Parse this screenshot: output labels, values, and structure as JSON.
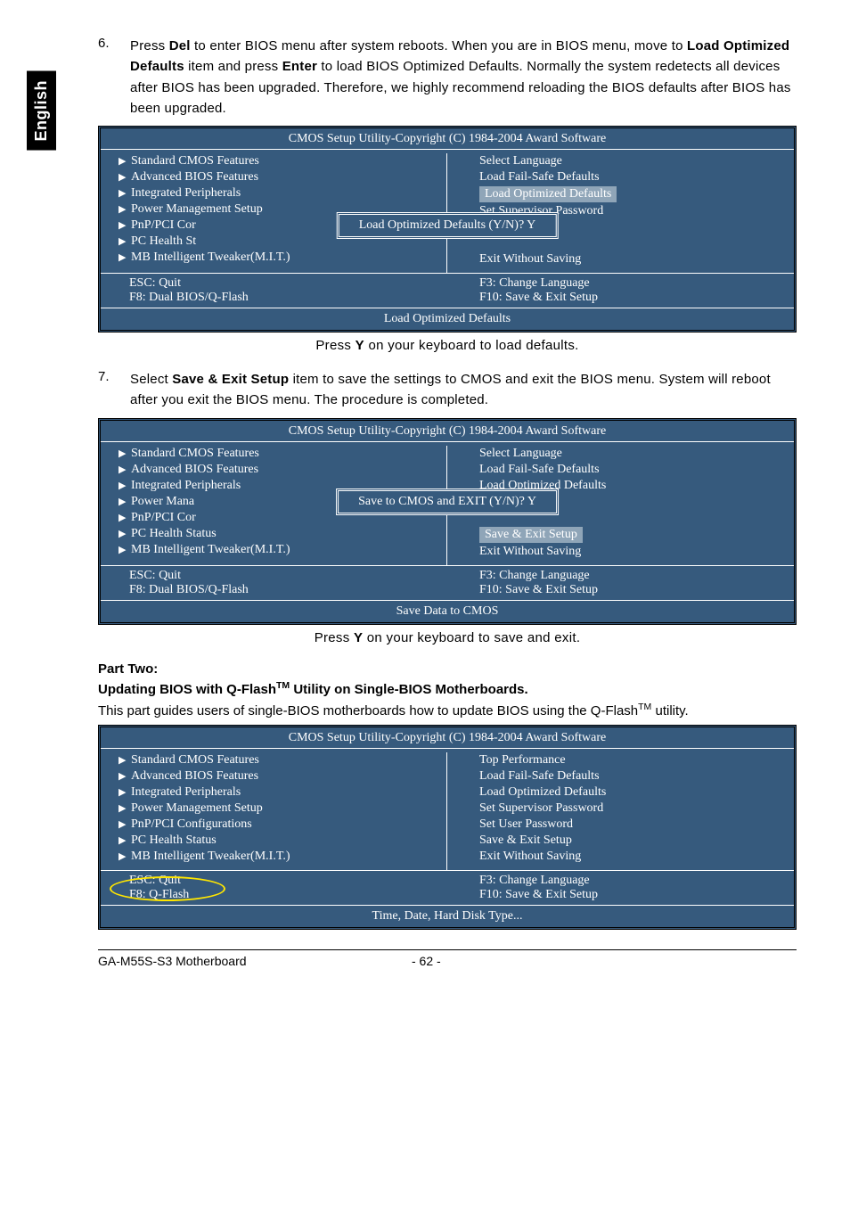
{
  "lang_tab": "English",
  "step6": {
    "num": "6.",
    "text_a": "Press ",
    "key1": "Del",
    "text_b": " to enter BIOS menu after system reboots. When you are in BIOS menu, move to ",
    "key2": "Load Optimized Defaults",
    "text_c": " item and press ",
    "key3": "Enter",
    "text_d": " to load BIOS Optimized Defaults. Normally the system redetects all devices after BIOS has been upgraded. Therefore, we highly recommend reloading the BIOS defaults after BIOS has been upgraded."
  },
  "bios1": {
    "title": "CMOS Setup Utility-Copyright (C) 1984-2004 Award Software",
    "left": [
      "Standard CMOS Features",
      "Advanced BIOS Features",
      "Integrated Peripherals",
      "Power Management Setup",
      "PnP/PCI Cor",
      "PC Health St",
      "MB Intelligent Tweaker(M.I.T.)"
    ],
    "right": [
      "Select Language",
      "Load Fail-Safe Defaults",
      "Load Optimized Defaults",
      "Set Supervisor Password",
      "",
      "",
      "Exit Without Saving"
    ],
    "popup": "Load Optimized Defaults (Y/N)? Y",
    "keys": {
      "l1": "ESC: Quit",
      "l2": "F8: Dual BIOS/Q-Flash",
      "r1": "F3: Change Language",
      "r2": "F10: Save & Exit Setup"
    },
    "status": "Load Optimized Defaults"
  },
  "caption1_a": "Press ",
  "caption1_b": "Y",
  "caption1_c": " on your keyboard to load defaults.",
  "step7": {
    "num": "7.",
    "text_a": "Select ",
    "key1": "Save & Exit Setup",
    "text_b": " item to save the settings to CMOS and exit the BIOS menu. System will reboot after you exit the BIOS menu. The procedure is completed."
  },
  "bios2": {
    "title": "CMOS Setup Utility-Copyright (C) 1984-2004 Award Software",
    "left": [
      "Standard CMOS Features",
      "Advanced BIOS Features",
      "Integrated Peripherals",
      "Power Mana",
      "PnP/PCI Cor",
      "PC Health Status",
      "MB Intelligent Tweaker(M.I.T.)"
    ],
    "right": [
      "Select Language",
      "Load Fail-Safe Defaults",
      "Load Optimized Defaults",
      "",
      "",
      "Save & Exit Setup",
      "Exit Without Saving"
    ],
    "popup": "Save to CMOS and EXIT (Y/N)? Y",
    "keys": {
      "l1": "ESC: Quit",
      "l2": "F8: Dual BIOS/Q-Flash",
      "r1": "F3: Change Language",
      "r2": "F10: Save & Exit Setup"
    },
    "status": "Save Data to CMOS"
  },
  "caption2_a": "Press ",
  "caption2_b": "Y",
  "caption2_c": " on your keyboard to save and exit.",
  "part2": {
    "head": "Part Two:",
    "sub_a": "Updating BIOS with Q-Flash",
    "sub_tm": "TM",
    "sub_b": " Utility on Single-BIOS Motherboards.",
    "intro_a": "This part guides users of single-BIOS motherboards how to update BIOS using the Q-Flash",
    "intro_tm": "TM",
    "intro_b": " utility."
  },
  "bios3": {
    "title": "CMOS Setup Utility-Copyright (C) 1984-2004 Award Software",
    "left": [
      "Standard CMOS Features",
      "Advanced BIOS Features",
      "Integrated Peripherals",
      "Power Management Setup",
      "PnP/PCI Configurations",
      "PC Health Status",
      "MB Intelligent Tweaker(M.I.T.)"
    ],
    "right": [
      "Top Performance",
      "Load Fail-Safe Defaults",
      "Load Optimized Defaults",
      "Set Supervisor Password",
      "Set User Password",
      "Save & Exit Setup",
      "Exit Without Saving"
    ],
    "keys": {
      "l1": "ESC: Quit",
      "l2": "F8: Q-Flash",
      "r1": "F3: Change Language",
      "r2": "F10: Save & Exit Setup"
    },
    "status": "Time, Date, Hard Disk Type..."
  },
  "footer": {
    "left": "GA-M55S-S3 Motherboard",
    "mid": "- 62 -"
  }
}
